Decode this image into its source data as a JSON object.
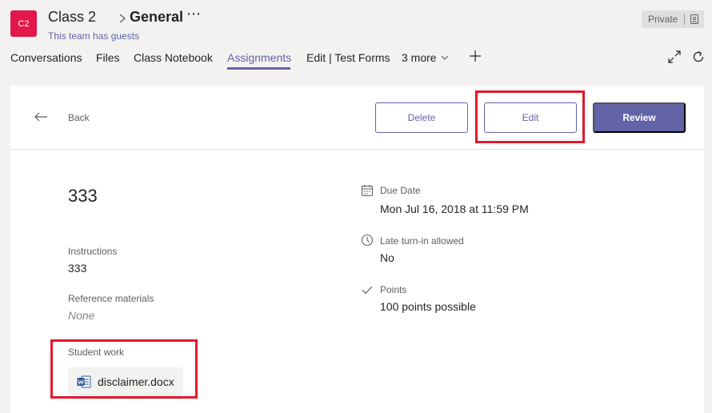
{
  "team": {
    "avatar_initials": "C2",
    "name": "Class 2",
    "channel": "General",
    "more": "⋯",
    "guest_note": "This team has guests",
    "privacy": "Private"
  },
  "tabs": [
    {
      "label": "Conversations"
    },
    {
      "label": "Files"
    },
    {
      "label": "Class Notebook"
    },
    {
      "label": "Assignments",
      "active": true
    },
    {
      "label": "Edit | Test Forms"
    },
    {
      "label": "3 more"
    }
  ],
  "toolbar": {
    "back_label": "Back",
    "delete_label": "Delete",
    "edit_label": "Edit",
    "review_label": "Review"
  },
  "assignment": {
    "title": "333",
    "instructions_label": "Instructions",
    "instructions_value": "333",
    "reference_label": "Reference materials",
    "reference_value": "None",
    "student_work_label": "Student work",
    "student_file": "disclaimer.docx",
    "due_label": "Due Date",
    "due_value": "Mon Jul 16, 2018 at 11:59 PM",
    "late_label": "Late turn-in allowed",
    "late_value": "No",
    "points_label": "Points",
    "points_value": "100 points possible"
  },
  "icons": {
    "back": "arrow-left-icon",
    "due": "calendar-icon",
    "late": "clock-icon",
    "points": "check-icon",
    "file": "word-doc-icon"
  },
  "colors": {
    "accent": "#6264a7",
    "team_tile": "#e3174a",
    "highlight": "#e3172e",
    "word_blue": "#2b579a"
  }
}
